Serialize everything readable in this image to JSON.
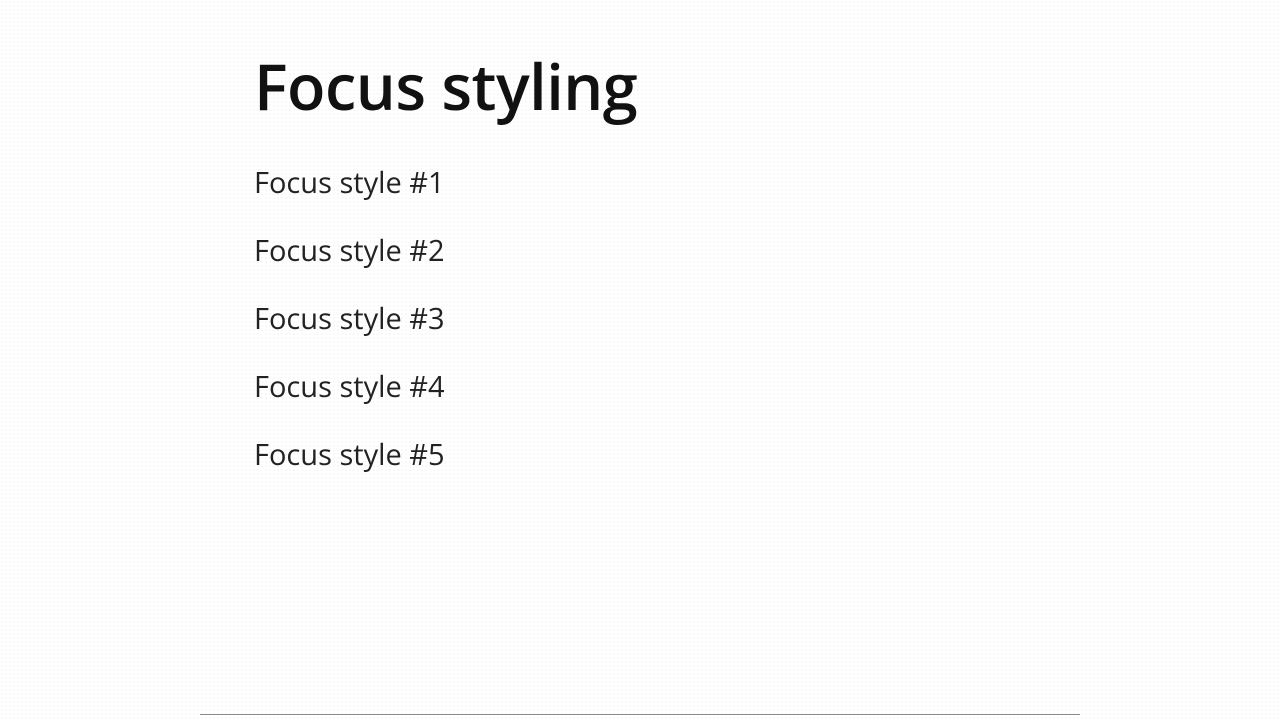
{
  "heading": "Focus styling",
  "links": [
    "Focus style #1",
    "Focus style #2",
    "Focus style #3",
    "Focus style #4",
    "Focus style #5"
  ]
}
